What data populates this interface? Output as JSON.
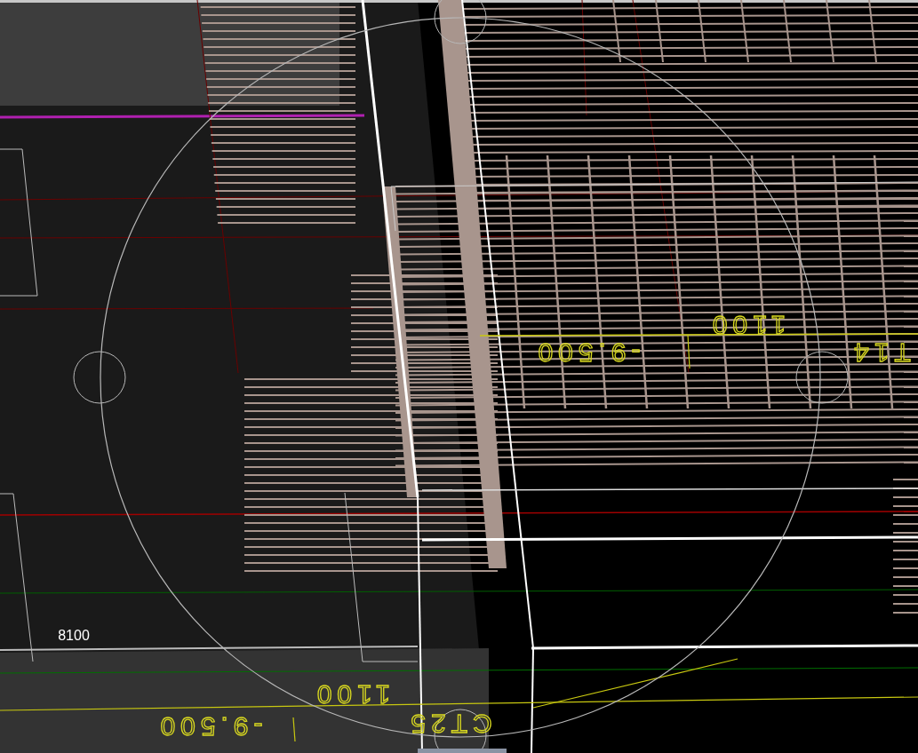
{
  "viewport": {
    "labels": [
      {
        "text": "1100",
        "kind": "flipped"
      },
      {
        "text": "-9.500",
        "kind": "flipped"
      },
      {
        "text": "T14",
        "kind": "flipped"
      },
      {
        "text": "8100",
        "kind": "plain"
      },
      {
        "text": "1100",
        "kind": "flipped"
      },
      {
        "text": "-9.500",
        "kind": "flipped"
      },
      {
        "text": "CT25",
        "kind": "flipped"
      }
    ]
  }
}
